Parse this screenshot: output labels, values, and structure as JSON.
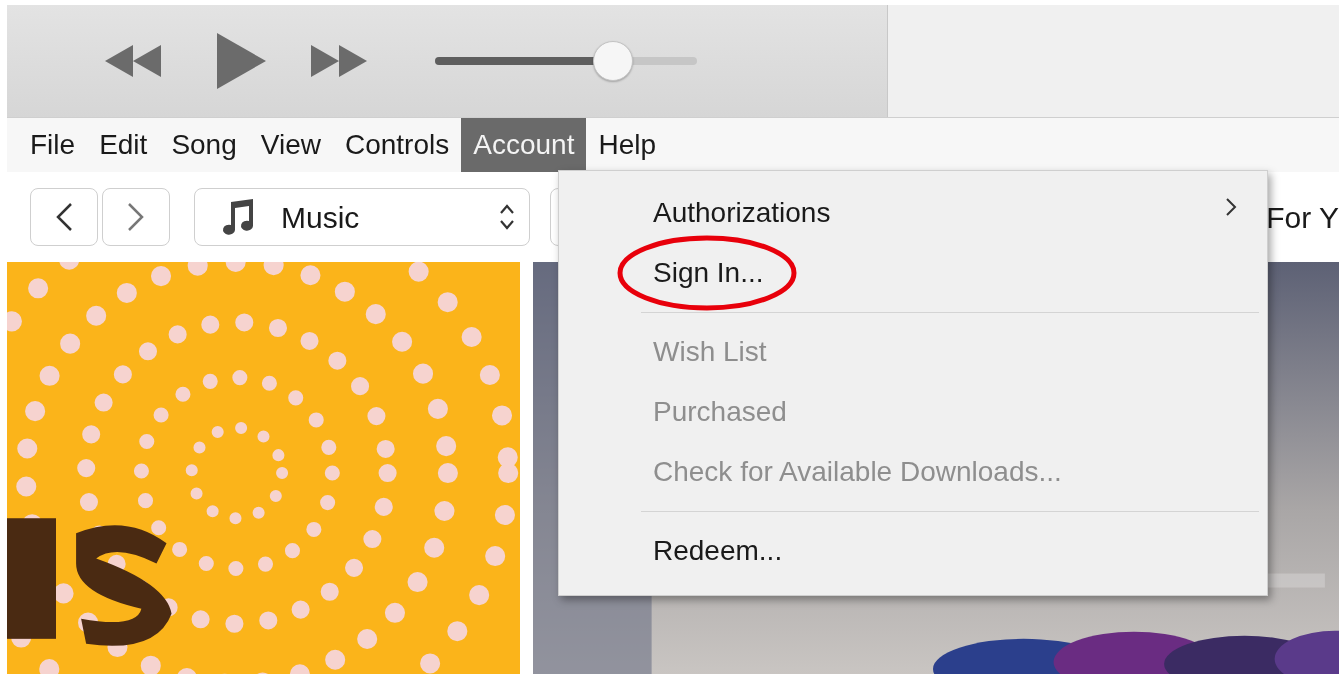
{
  "player": {
    "volume": {
      "level": 0.68
    }
  },
  "menu_bar": [
    {
      "label": "File",
      "selected": false
    },
    {
      "label": "Edit",
      "selected": false
    },
    {
      "label": "Song",
      "selected": false
    },
    {
      "label": "View",
      "selected": false
    },
    {
      "label": "Controls",
      "selected": false
    },
    {
      "label": "Account",
      "selected": true
    },
    {
      "label": "Help",
      "selected": false
    }
  ],
  "navigation": {
    "library_picker": {
      "label": "Music"
    },
    "tab_partial": "For Y"
  },
  "account_menu": {
    "items": [
      {
        "kind": "submenu",
        "label": "Authorizations",
        "disabled": false,
        "circled": false
      },
      {
        "kind": "item",
        "label": "Sign In...",
        "disabled": false,
        "circled": true
      },
      {
        "kind": "separator"
      },
      {
        "kind": "item",
        "label": "Wish List",
        "disabled": true,
        "circled": false
      },
      {
        "kind": "item",
        "label": "Purchased",
        "disabled": true,
        "circled": false
      },
      {
        "kind": "item",
        "label": "Check for Available Downloads...",
        "disabled": true,
        "circled": false
      },
      {
        "kind": "separator"
      },
      {
        "kind": "item",
        "label": "Redeem...",
        "disabled": false,
        "circled": false
      }
    ]
  }
}
